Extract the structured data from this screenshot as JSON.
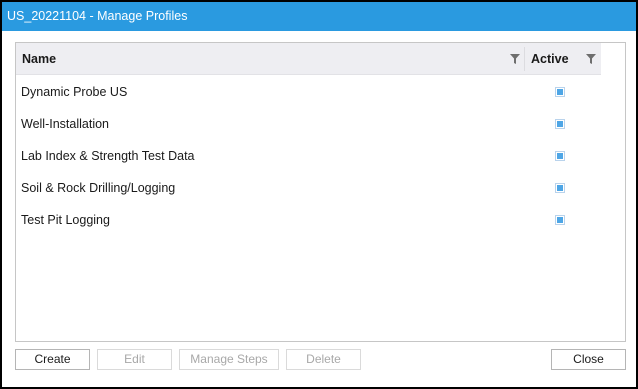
{
  "window": {
    "title": "US_20221104 - Manage Profiles"
  },
  "grid": {
    "columns": {
      "name": "Name",
      "active": "Active"
    },
    "rows": [
      {
        "name": "Dynamic Probe US",
        "active": true
      },
      {
        "name": "Well-Installation",
        "active": true
      },
      {
        "name": "Lab Index & Strength Test Data",
        "active": true
      },
      {
        "name": "Soil & Rock Drilling/Logging",
        "active": true
      },
      {
        "name": "Test Pit Logging",
        "active": true
      }
    ]
  },
  "buttons": {
    "create": "Create",
    "edit": "Edit",
    "manage_steps": "Manage Steps",
    "delete": "Delete",
    "close": "Close"
  },
  "colors": {
    "titlebar": "#2a9ae0",
    "checkbox_fill": "#4ea6e6"
  },
  "icons": {
    "column_filter": "filter-icon"
  }
}
